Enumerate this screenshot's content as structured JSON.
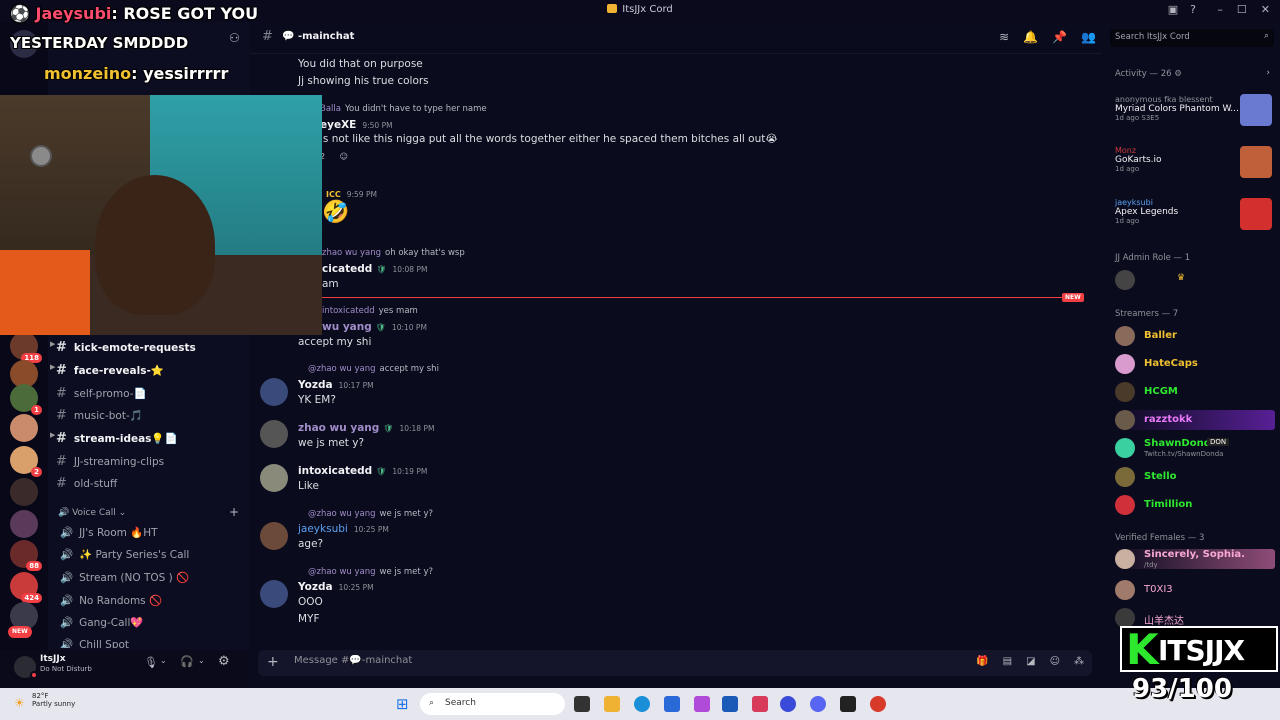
{
  "window": {
    "title": "ItsJJx Cord"
  },
  "server": {
    "name": "ItsJJx Cord"
  },
  "overlay": {
    "chat": [
      {
        "user": "Jaeysubi",
        "text": "ROSE GOT YOU"
      },
      {
        "user": "",
        "text": "YESTERDAY SMDDDD"
      },
      {
        "user": "monzeino",
        "text": "yessirrrrr"
      }
    ],
    "brand": "ITSJJX",
    "counter": "93/100"
  },
  "rail_badges": [
    "118",
    "1",
    "2",
    "88",
    "424",
    "NEW"
  ],
  "channels": [
    {
      "name": "kick-emote-requests",
      "bold": true
    },
    {
      "name": "face-reveals-⭐",
      "bold": true
    },
    {
      "name": "self-promo-📄",
      "bold": false
    },
    {
      "name": "music-bot-🎵",
      "bold": false
    },
    {
      "name": "stream-ideas💡📄",
      "bold": true
    },
    {
      "name": "JJ-streaming-clips",
      "bold": false
    },
    {
      "name": "old-stuff",
      "bold": false
    }
  ],
  "voice_category": "Voice Call",
  "voice_channels": [
    {
      "name": "JJ's Room 🔥HT"
    },
    {
      "name": "✨ Party Series's Call"
    },
    {
      "name": "Stream (NO TOS ) 🚫"
    },
    {
      "name": "No Randoms 🚫"
    },
    {
      "name": "Gang-Call💖"
    },
    {
      "name": "Chill Spot"
    }
  ],
  "user": {
    "name": "ItsJJx",
    "status": "Do Not Disturb"
  },
  "chat": {
    "channel": "-mainchat",
    "composer_placeholder": "Message #💬-mainchat",
    "new_label": "NEW",
    "messages": [
      {
        "text": "You did that on purpose"
      },
      {
        "text": "Jj showing his true colors"
      },
      {
        "reply_author": "Balla",
        "reply_text": "You didn't have to type her name"
      },
      {
        "author": "eyeXE",
        "time": "9:50 PM",
        "text": "'s not like this nigga put all the words together either he spaced them bitches all out😭"
      },
      {
        "reaction_count": "2"
      },
      {
        "author": "ICC",
        "time": "9:59 PM",
        "text": "🤣"
      },
      {
        "reply_author": "zhao wu yang",
        "reply_text": "oh okay that's wsp"
      },
      {
        "author": "cicatedd",
        "time": "10:08 PM",
        "text": "am"
      },
      {
        "reply_author": "intoxicatedd",
        "reply_text": "yes mam"
      },
      {
        "author": "wu yang",
        "time": "10:10 PM",
        "text": "accept my shi"
      },
      {
        "reply_author": "@zhao wu yang",
        "reply_text": "accept my shi"
      },
      {
        "author": "Yozda",
        "time": "10:17 PM",
        "text": "YK EM?"
      },
      {
        "author": "zhao wu yang",
        "time": "10:18 PM",
        "text": "we js met y?"
      },
      {
        "author": "intoxicatedd",
        "time": "10:19 PM",
        "text": "Like"
      },
      {
        "reply_author": "@zhao wu yang",
        "reply_text": "we js met y?"
      },
      {
        "author": "jaeyksubi",
        "time": "10:25 PM",
        "text": "age?"
      },
      {
        "reply_author": "@zhao wu yang",
        "reply_text": "we js met y?"
      },
      {
        "author": "Yozda",
        "time": "10:25 PM",
        "text": "OOO"
      },
      {
        "text": "MYF"
      }
    ]
  },
  "members": {
    "search_placeholder": "Search ItsJJx Cord",
    "activity_header": "Activity — 26",
    "activities": [
      {
        "who": "anonymous fka blessent",
        "game": "Myriad Colors Phantom W...",
        "ago": "1d ago",
        "tag": "S3E5"
      },
      {
        "who": "Monz",
        "game": "GoKarts.io",
        "ago": "1d ago"
      },
      {
        "who": "jaeyksubi",
        "game": "Apex Legends",
        "ago": "1d ago"
      }
    ],
    "sections": [
      {
        "title": "JJ Admin Role — 1",
        "items": [
          {
            "name": ""
          }
        ]
      },
      {
        "title": "Streamers — 7",
        "items": [
          {
            "name": "Baller",
            "color": "#f0c030"
          },
          {
            "name": "HateCaps",
            "color": "#f0c030"
          },
          {
            "name": "HCGM",
            "color": "#2ee82e"
          },
          {
            "name": "razztokk",
            "color": "#e879f9"
          },
          {
            "name": "ShawnDonda",
            "color": "#2ee82e",
            "sub": "Twitch.tv/ShawnDonda",
            "tag": "DON"
          },
          {
            "name": "Stello",
            "color": "#2ee82e"
          },
          {
            "name": "Timillion",
            "color": "#2ee82e"
          }
        ]
      },
      {
        "title": "Verified Females — 3",
        "items": [
          {
            "name": "Sincerely, Sophia.",
            "color": "#f9a8d4",
            "sub": "/tdy"
          },
          {
            "name": "T0XI3",
            "color": "#f9a8d4"
          },
          {
            "name": "山羊杰达",
            "color": "#f9a8d4"
          }
        ]
      }
    ]
  },
  "taskbar": {
    "weather_temp": "82°F",
    "weather_desc": "Partly sunny",
    "search": "Search"
  },
  "colors": {
    "accent_red": "#f23f43",
    "brand_green": "#2ee82e",
    "bg": "#0b0b1e"
  }
}
